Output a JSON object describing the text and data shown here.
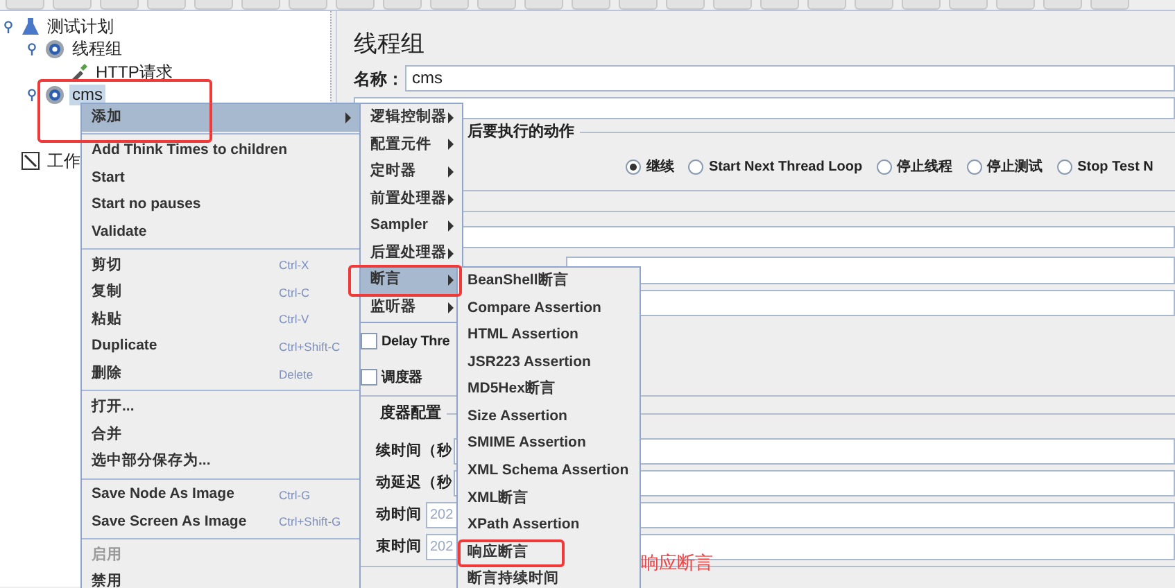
{
  "tree": [
    {
      "label": "测试计划",
      "kind": "plan",
      "expanded": true,
      "selected": false,
      "children": [
        {
          "label": "线程组",
          "kind": "gear",
          "expanded": true,
          "selected": false,
          "children": [
            {
              "label": "HTTP请求",
              "kind": "dropper",
              "selected": false
            }
          ]
        },
        {
          "label": "cms",
          "kind": "gear",
          "expanded": true,
          "selected": true
        }
      ]
    },
    {
      "label": "工作",
      "kind": "notepad",
      "selected": false
    }
  ],
  "panel": {
    "title": "线程组",
    "name_label": "名称：",
    "name_value": "cms",
    "action_legend": "后要执行的动作",
    "actions": [
      {
        "label": "继续",
        "selected": true
      },
      {
        "label": "Start Next Thread Loop",
        "selected": false
      },
      {
        "label": "停止线程",
        "selected": false
      },
      {
        "label": "停止测试",
        "selected": false
      },
      {
        "label": "Stop Test N",
        "selected": false
      }
    ],
    "checkboxes": [
      {
        "label": "Delay Thre",
        "checked": false
      },
      {
        "label": "调度器",
        "checked": false
      }
    ],
    "scheduler_legend": "度器配置",
    "scheduler_fields": [
      {
        "label": "续时间（秒"
      },
      {
        "label": "动延迟（秒"
      },
      {
        "label": "动时间",
        "value": "202"
      },
      {
        "label": "束时间",
        "value": "202"
      }
    ]
  },
  "context_menu": [
    {
      "kind": "item",
      "label": "添加",
      "submenu": true,
      "selected": true,
      "disabled": false
    },
    {
      "kind": "separator"
    },
    {
      "kind": "item",
      "label": "Add Think Times to children",
      "selected": false,
      "disabled": false
    },
    {
      "kind": "item",
      "label": "Start",
      "selected": false,
      "disabled": false
    },
    {
      "kind": "item",
      "label": "Start no pauses",
      "selected": false,
      "disabled": false
    },
    {
      "kind": "item",
      "label": "Validate",
      "selected": false,
      "disabled": false
    },
    {
      "kind": "separator"
    },
    {
      "kind": "item",
      "label": "剪切",
      "shortcut": "Ctrl-X",
      "selected": false,
      "disabled": false
    },
    {
      "kind": "item",
      "label": "复制",
      "shortcut": "Ctrl-C",
      "selected": false,
      "disabled": false
    },
    {
      "kind": "item",
      "label": "粘贴",
      "shortcut": "Ctrl-V",
      "selected": false,
      "disabled": false
    },
    {
      "kind": "item",
      "label": "Duplicate",
      "shortcut": "Ctrl+Shift-C",
      "selected": false,
      "disabled": false
    },
    {
      "kind": "item",
      "label": "删除",
      "shortcut": "Delete",
      "selected": false,
      "disabled": false
    },
    {
      "kind": "separator"
    },
    {
      "kind": "item",
      "label": "打开...",
      "selected": false,
      "disabled": false
    },
    {
      "kind": "item",
      "label": "合并",
      "selected": false,
      "disabled": false
    },
    {
      "kind": "item",
      "label": "选中部分保存为...",
      "selected": false,
      "disabled": false
    },
    {
      "kind": "separator"
    },
    {
      "kind": "item",
      "label": "Save Node As Image",
      "shortcut": "Ctrl-G",
      "selected": false,
      "disabled": false
    },
    {
      "kind": "item",
      "label": "Save Screen As Image",
      "shortcut": "Ctrl+Shift-G",
      "selected": false,
      "disabled": false
    },
    {
      "kind": "separator"
    },
    {
      "kind": "item",
      "label": "启用",
      "selected": false,
      "disabled": true
    },
    {
      "kind": "item",
      "label": "禁用",
      "selected": false,
      "disabled": false
    }
  ],
  "add_menu": [
    {
      "label": "逻辑控制器",
      "submenu": true,
      "selected": false
    },
    {
      "label": "配置元件",
      "submenu": true,
      "selected": false
    },
    {
      "label": "定时器",
      "submenu": true,
      "selected": false
    },
    {
      "label": "前置处理器",
      "submenu": true,
      "selected": false
    },
    {
      "label": "Sampler",
      "submenu": true,
      "selected": false
    },
    {
      "label": "后置处理器",
      "submenu": true,
      "selected": false
    },
    {
      "label": "断言",
      "submenu": true,
      "selected": true
    },
    {
      "label": "监听器",
      "submenu": true,
      "selected": false
    }
  ],
  "assertion_menu": [
    {
      "label": "BeanShell断言",
      "selected": false,
      "boxed": false
    },
    {
      "label": "Compare Assertion",
      "selected": false,
      "boxed": false
    },
    {
      "label": "HTML Assertion",
      "selected": false,
      "boxed": false
    },
    {
      "label": "JSR223 Assertion",
      "selected": false,
      "boxed": false
    },
    {
      "label": "MD5Hex断言",
      "selected": false,
      "boxed": false
    },
    {
      "label": "Size Assertion",
      "selected": false,
      "boxed": false
    },
    {
      "label": "SMIME Assertion",
      "selected": false,
      "boxed": false
    },
    {
      "label": "XML Schema Assertion",
      "selected": false,
      "boxed": false
    },
    {
      "label": "XML断言",
      "selected": false,
      "boxed": false
    },
    {
      "label": "XPath Assertion",
      "selected": false,
      "boxed": false
    },
    {
      "label": "响应断言",
      "selected": false,
      "boxed": true
    },
    {
      "label": "断言持续时间",
      "selected": false,
      "boxed": false
    }
  ],
  "callout": "响应断言"
}
